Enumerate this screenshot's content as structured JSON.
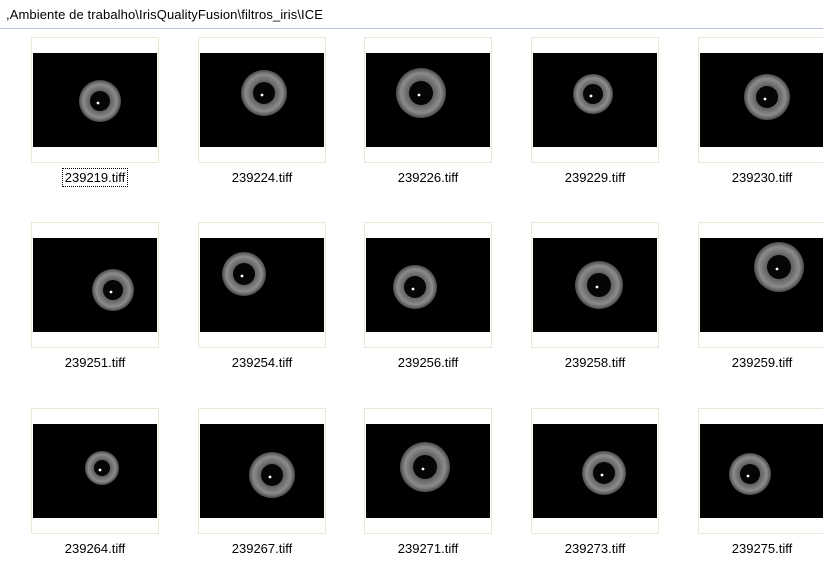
{
  "address_bar": {
    "path": ",Ambiente de trabalho\\IrisQualityFusion\\filtros_iris\\ICE"
  },
  "files": [
    {
      "name": "239219.tiff",
      "selected": true
    },
    {
      "name": "239224.tiff"
    },
    {
      "name": "239226.tiff"
    },
    {
      "name": "239229.tiff"
    },
    {
      "name": "239230.tiff"
    },
    {
      "name": "239251.tiff"
    },
    {
      "name": "239254.tiff"
    },
    {
      "name": "239256.tiff"
    },
    {
      "name": "239258.tiff"
    },
    {
      "name": "239259.tiff"
    },
    {
      "name": "239264.tiff"
    },
    {
      "name": "239267.tiff"
    },
    {
      "name": "239271.tiff"
    },
    {
      "name": "239273.tiff"
    },
    {
      "name": "239275.tiff"
    }
  ]
}
